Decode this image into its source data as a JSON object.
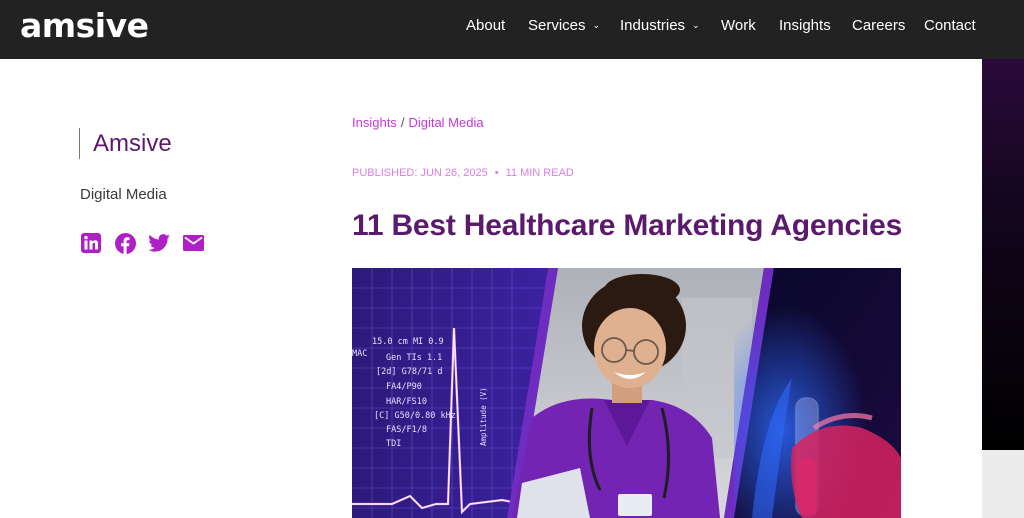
{
  "header": {
    "logo": "amsive",
    "nav": [
      {
        "label": "About",
        "has_dropdown": false
      },
      {
        "label": "Services",
        "has_dropdown": true
      },
      {
        "label": "Industries",
        "has_dropdown": true
      },
      {
        "label": "Work",
        "has_dropdown": false
      },
      {
        "label": "Insights",
        "has_dropdown": false
      },
      {
        "label": "Careers",
        "has_dropdown": false
      },
      {
        "label": "Contact",
        "has_dropdown": false
      }
    ]
  },
  "sidebar": {
    "author": "Amsive",
    "category": "Digital Media",
    "share_icons": [
      "linkedin-icon",
      "facebook-icon",
      "twitter-icon",
      "email-icon"
    ]
  },
  "article": {
    "breadcrumb": [
      "Insights",
      "Digital Media"
    ],
    "breadcrumb_separator": "/",
    "published": "PUBLISHED: JUN 26, 2025",
    "separator": "•",
    "read_time": "11 MIN READ",
    "title": "11 Best Healthcare Marketing Agencies",
    "hero_readout": [
      "15.0 cm MI 0.9",
      "Gen TIs 1.1",
      "[2d] G78/71 d",
      "FA4/P90",
      "HAR/FS10",
      "[C] G50/0.80 kHz",
      "FAS/F1/8",
      "TDI"
    ],
    "hero_side_text": "MAC",
    "hero_axis_label": "Amplitude (V)"
  },
  "colors": {
    "header_bg": "#222222",
    "brand_purple": "#5b1a6b",
    "accent_magenta": "#c23bd4",
    "meta_pink": "#d77fe3",
    "icon_magenta": "#b01ec8"
  }
}
